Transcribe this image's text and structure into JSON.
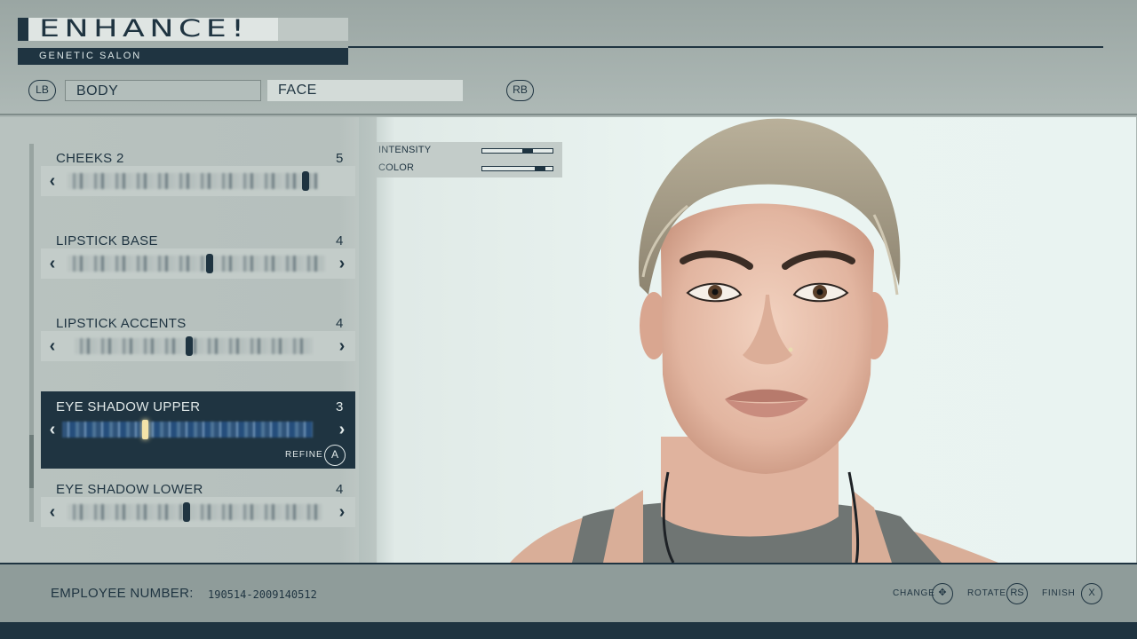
{
  "header": {
    "logo": "ENHANCE!",
    "subtitle": "GENETIC SALON",
    "tabs": {
      "prev_button": "LB",
      "next_button": "RB",
      "items": [
        {
          "label": "BODY",
          "active": false
        },
        {
          "label": "FACE",
          "active": true
        }
      ]
    }
  },
  "options": [
    {
      "label": "CHEEKS 2",
      "value": "5",
      "level": 0.95
    },
    {
      "label": "LIPSTICK BASE",
      "value": "4",
      "level": 0.55
    },
    {
      "label": "LIPSTICK ACCENTS",
      "value": "4",
      "level": 0.48
    },
    {
      "label": "EYE SHADOW UPPER",
      "value": "3",
      "level": 0.33,
      "selected": true
    },
    {
      "label": "EYE SHADOW LOWER",
      "value": "4",
      "level": 0.47
    }
  ],
  "refine": {
    "label": "REFINE",
    "button": "A"
  },
  "adjust": {
    "intensity": {
      "label": "INTENSITY",
      "level": 0.72
    },
    "color": {
      "label": "COLOR",
      "level": 0.9
    }
  },
  "footer": {
    "employee_label": "EMPLOYEE NUMBER:",
    "employee_number": "190514-2009140512",
    "hints": [
      {
        "label": "CHANGE",
        "button": "✥"
      },
      {
        "label": "ROTATE",
        "button": "RS"
      },
      {
        "label": "FINISH",
        "button": "X"
      }
    ]
  },
  "colors": {
    "accent": "#1f3441",
    "panel": "#c3ccc9",
    "highlight": "#f3e3a8"
  }
}
